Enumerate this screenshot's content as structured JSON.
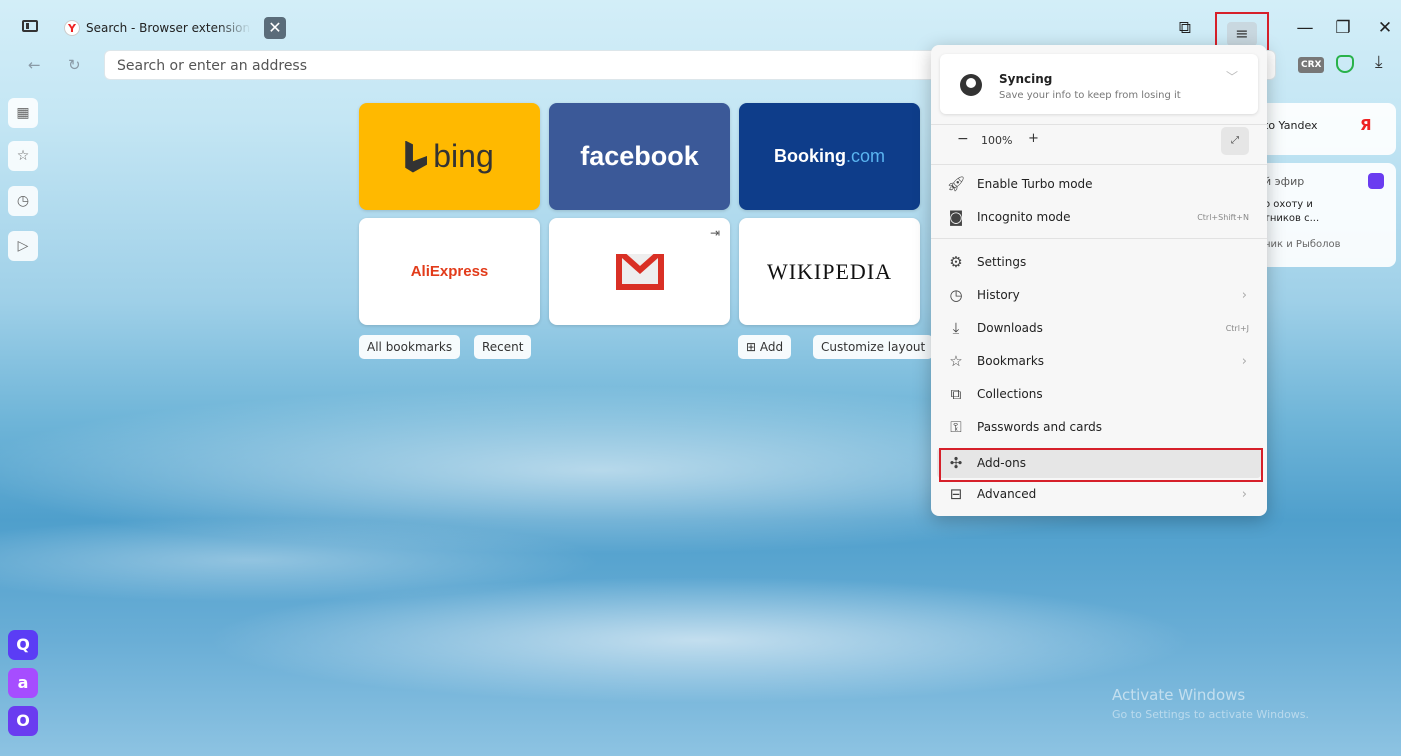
{
  "browser": {
    "tab": {
      "title": "Search - Browser extensions",
      "favicon": "Y"
    },
    "address_placeholder": "Search or enter an address",
    "crx_label": "CRX"
  },
  "speed_dial": {
    "tiles": [
      {
        "id": "bing",
        "label": "bing",
        "bg": "#ffb900"
      },
      {
        "id": "facebook",
        "label": "facebook",
        "bg": "#3b5998"
      },
      {
        "id": "booking",
        "label": "Booking",
        "suffix": ".com",
        "bg": "#0e3d8a"
      },
      {
        "id": "aliexpress",
        "label": "AliExpress",
        "bg": "#ffffff"
      },
      {
        "id": "gmail",
        "label": "",
        "bg": "#ffffff"
      },
      {
        "id": "wikipedia",
        "label": "WIKIPEDIA",
        "bg": "#ffffff"
      }
    ],
    "pills": {
      "all_bookmarks": "All bookmarks",
      "recent": "Recent",
      "add": "Add",
      "customize": "Customize layout"
    }
  },
  "widgets": {
    "yandex": {
      "text": "to Yandex",
      "logo": "Я"
    },
    "news": {
      "line1": "й эфир",
      "line2": "о охоту и",
      "line3": "тников с...",
      "line4": "ник и Рыболов"
    }
  },
  "watermark": {
    "line1": "Activate Windows",
    "line2": "Go to Settings to activate Windows."
  },
  "menu": {
    "sync": {
      "title": "Syncing",
      "subtitle": "Save your info to keep from losing it"
    },
    "zoom": {
      "minus": "−",
      "value": "100%",
      "plus": "+"
    },
    "items": [
      {
        "label": "Enable Turbo mode",
        "icon": "rocket-icon",
        "shortcut": "",
        "arrow": false
      },
      {
        "label": "Incognito mode",
        "icon": "incognito-icon",
        "shortcut": "Ctrl+Shift+N",
        "arrow": false
      },
      {
        "label": "Settings",
        "icon": "gear-icon",
        "shortcut": "",
        "arrow": false
      },
      {
        "label": "History",
        "icon": "clock-icon",
        "shortcut": "",
        "arrow": true
      },
      {
        "label": "Downloads",
        "icon": "download-icon",
        "shortcut": "Ctrl+J",
        "arrow": false
      },
      {
        "label": "Bookmarks",
        "icon": "star-icon",
        "shortcut": "",
        "arrow": true
      },
      {
        "label": "Collections",
        "icon": "collections-icon",
        "shortcut": "",
        "arrow": false
      },
      {
        "label": "Passwords and cards",
        "icon": "key-card-icon",
        "shortcut": "",
        "arrow": false
      },
      {
        "label": "Add-ons",
        "icon": "puzzle-icon",
        "shortcut": "",
        "arrow": false
      },
      {
        "label": "Advanced",
        "icon": "more-icon",
        "shortcut": "",
        "arrow": true
      }
    ]
  },
  "colors": {
    "highlight": "#d6202a",
    "bing": "#ffb900",
    "facebook": "#3b5998",
    "booking": "#0e3d8a",
    "gmail": "#d93025"
  }
}
